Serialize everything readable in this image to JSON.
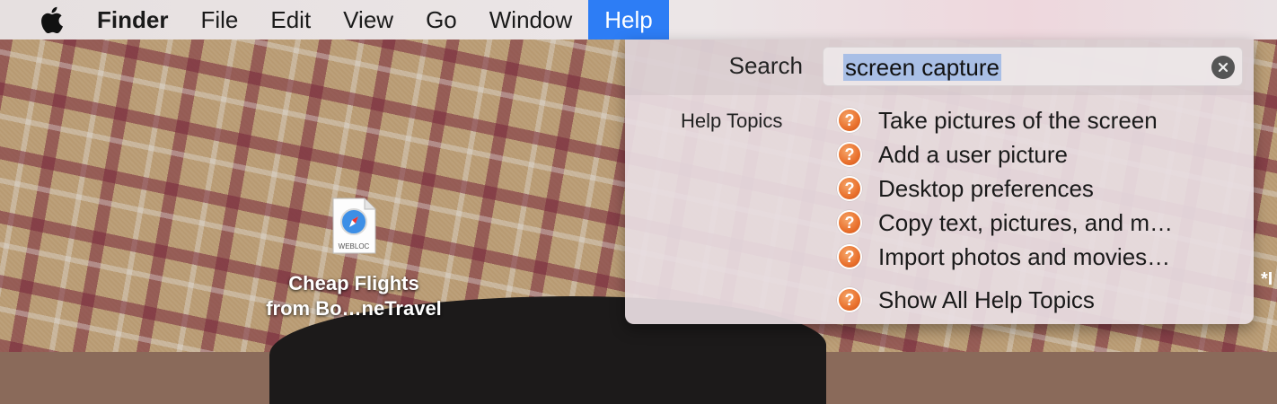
{
  "menubar": {
    "apple_icon": "apple-logo-icon",
    "app_name": "Finder",
    "items": [
      "File",
      "Edit",
      "View",
      "Go",
      "Window",
      "Help"
    ],
    "active_item": "Help",
    "active_color": "#2d7df5"
  },
  "help_menu": {
    "search_label": "Search",
    "search_value": "screen capture",
    "clear_icon": "clear-icon",
    "topics_label": "Help Topics",
    "topic_icon": "help-question-icon",
    "topics": [
      "Take pictures of the screen",
      "Add a user picture",
      "Desktop preferences",
      "Copy text, pictures, and m…",
      "Import photos and movies…"
    ],
    "show_all": "Show All Help Topics"
  },
  "desktop": {
    "file": {
      "badge": "WEBLOC",
      "label_line1": "Cheap Flights",
      "label_line2": "from Bo…neTravel"
    },
    "edge_text": "*I"
  }
}
